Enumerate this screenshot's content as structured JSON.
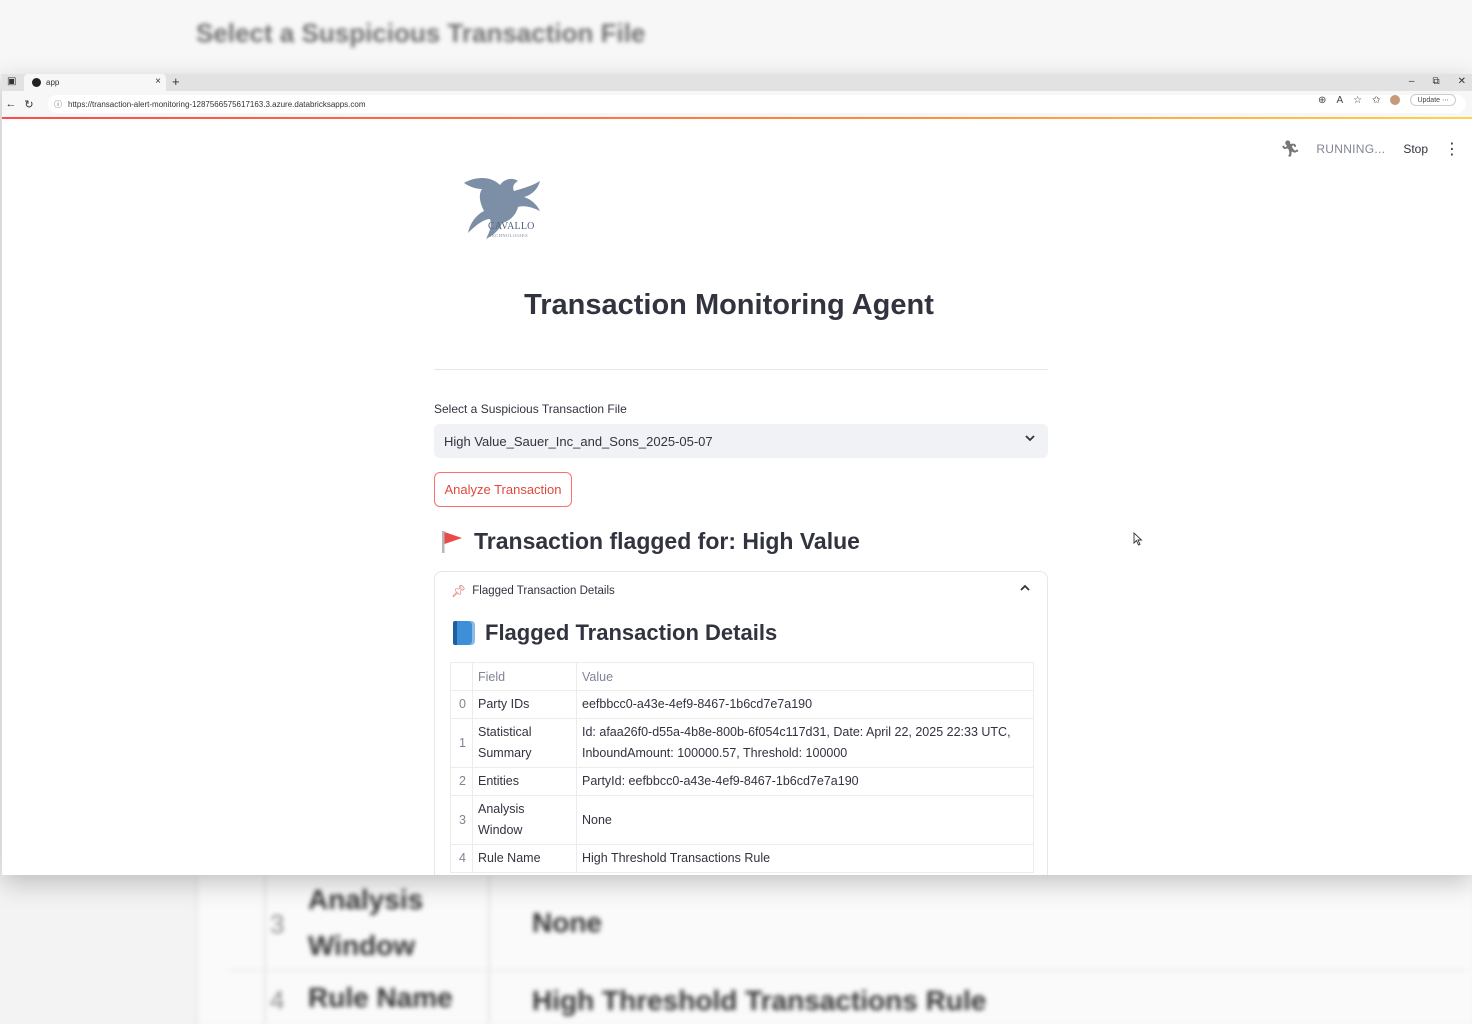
{
  "backdrop": {
    "title": "Select a Suspicious Transaction File",
    "rows": [
      {
        "index": "3",
        "field": "Analysis Window",
        "value": "None"
      },
      {
        "index": "4",
        "field": "Rule Name",
        "value": "High Threshold Transactions Rule"
      }
    ]
  },
  "browser": {
    "tab_title": "app",
    "url": "https://transaction-alert-monitoring-1287566575617163.3.azure.databricksapps.com",
    "update_label": "Update",
    "new_tab_glyph": "+",
    "close_glyph": "×"
  },
  "status": {
    "running_text": "RUNNING...",
    "stop_label": "Stop",
    "menu_glyph": "⋮"
  },
  "logo": {
    "brand": "CAVALLO",
    "sub": "TECHNOLOGIES",
    "color": "#7d8fa6"
  },
  "app": {
    "title": "Transaction Monitoring Agent",
    "select_label": "Select a Suspicious Transaction File",
    "select_value": "High Value_Sauer_Inc_and_Sons_2025-05-07",
    "analyze_button": "Analyze Transaction",
    "flag_heading": "Transaction flagged for: High Value",
    "expander_label": "Flagged Transaction Details",
    "details_title": "Flagged Transaction Details"
  },
  "table": {
    "columns": [
      "",
      "Field",
      "Value"
    ],
    "rows": [
      {
        "index": "0",
        "field": "Party IDs",
        "value": "eefbbcc0-a43e-4ef9-8467-1b6cd7e7a190"
      },
      {
        "index": "1",
        "field": "Statistical Summary",
        "value": "Id: afaa26f0-d55a-4b8e-800b-6f054c117d31, Date: April 22, 2025 22:33 UTC, InboundAmount: 100000.57, Threshold: 100000"
      },
      {
        "index": "2",
        "field": "Entities",
        "value": "PartyId: eefbbcc0-a43e-4ef9-8467-1b6cd7e7a190"
      },
      {
        "index": "3",
        "field": "Analysis Window",
        "value": "None"
      },
      {
        "index": "4",
        "field": "Rule Name",
        "value": "High Threshold Transactions Rule"
      }
    ]
  },
  "colors": {
    "accent": "#ff4b4b",
    "button_text": "#e0483f",
    "text": "#31333f",
    "muted": "#808495"
  },
  "icons": [
    "back-arrow-icon",
    "reload-icon",
    "lock-icon",
    "zoom-icon",
    "read-aloud-icon",
    "star-icon",
    "favorites-icon",
    "runner-icon",
    "kebab-menu-icon",
    "chevron-down-icon",
    "red-flag-icon",
    "pushpin-icon",
    "chevron-up-icon",
    "blue-book-icon",
    "mouse-cursor-icon"
  ]
}
